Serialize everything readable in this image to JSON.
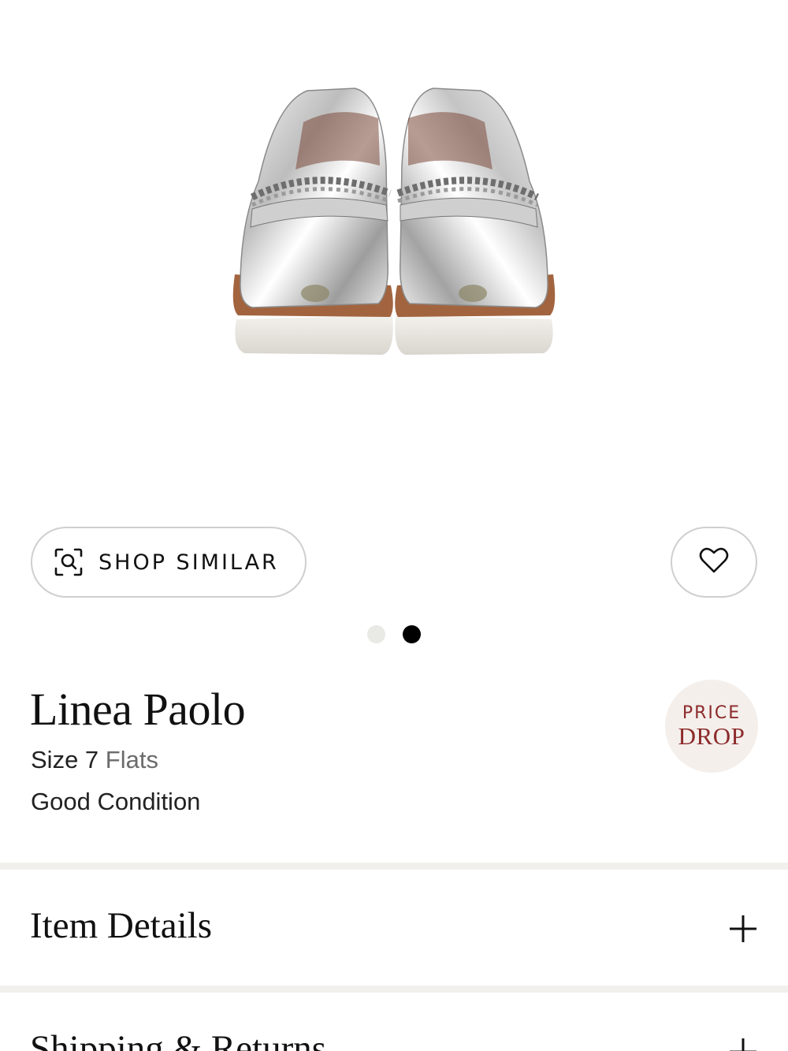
{
  "product": {
    "image_alt": "Silver metallic chain loafers",
    "brand": "Linea Paolo",
    "size_label": "Size 7",
    "category": "Flats",
    "condition": "Good Condition",
    "badge": {
      "line1": "PRICE",
      "line2": "DROP"
    }
  },
  "actions": {
    "shop_similar_label": "SHOP SIMILAR",
    "shop_similar_icon": "visual-search-icon",
    "favorite_icon": "heart-icon"
  },
  "carousel": {
    "total": 2,
    "active_index": 1
  },
  "sections": [
    {
      "title": "Item Details",
      "icon": "plus-icon"
    },
    {
      "title": "Shipping & Returns",
      "icon": "plus-icon"
    }
  ],
  "colors": {
    "accent": "#8c2b2b",
    "badge_bg": "#f4efeb",
    "divider": "#f1f0ed",
    "border": "#cfcfcf"
  }
}
